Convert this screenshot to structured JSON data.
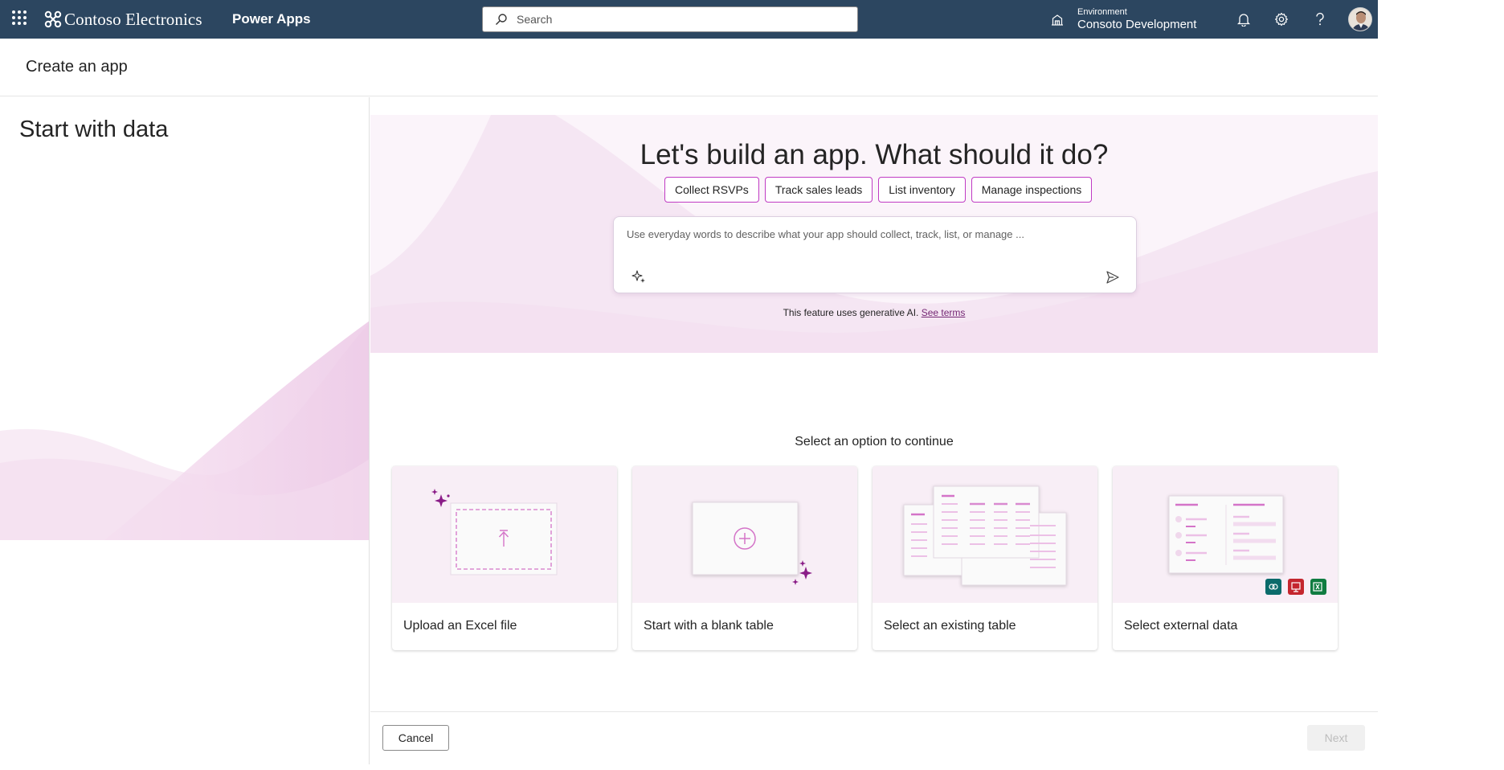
{
  "topbar": {
    "brand": "Contoso Electronics",
    "app_name": "Power Apps",
    "search_placeholder": "Search",
    "environment_label": "Environment",
    "environment_name": "Consoto Development"
  },
  "header": {
    "title": "Create an app"
  },
  "left_panel": {
    "title": "Start with data"
  },
  "hero": {
    "title": "Let's build an app. What should it do?",
    "chips": [
      "Collect RSVPs",
      "Track sales leads",
      "List inventory",
      "Manage inspections"
    ],
    "prompt_placeholder": "Use everyday words to describe what your app should collect, track, list, or manage ...",
    "ai_note": "This feature uses generative AI.",
    "see_terms": "See terms"
  },
  "options": {
    "title": "Select an option to continue",
    "cards": [
      {
        "label": "Upload an Excel file"
      },
      {
        "label": "Start with a blank table"
      },
      {
        "label": "Select an existing table"
      },
      {
        "label": "Select external data"
      }
    ]
  },
  "footer": {
    "cancel": "Cancel",
    "next": "Next"
  },
  "colors": {
    "topbar": "#2c4660",
    "accent": "#c03bc4",
    "brand_purple": "#742774"
  }
}
